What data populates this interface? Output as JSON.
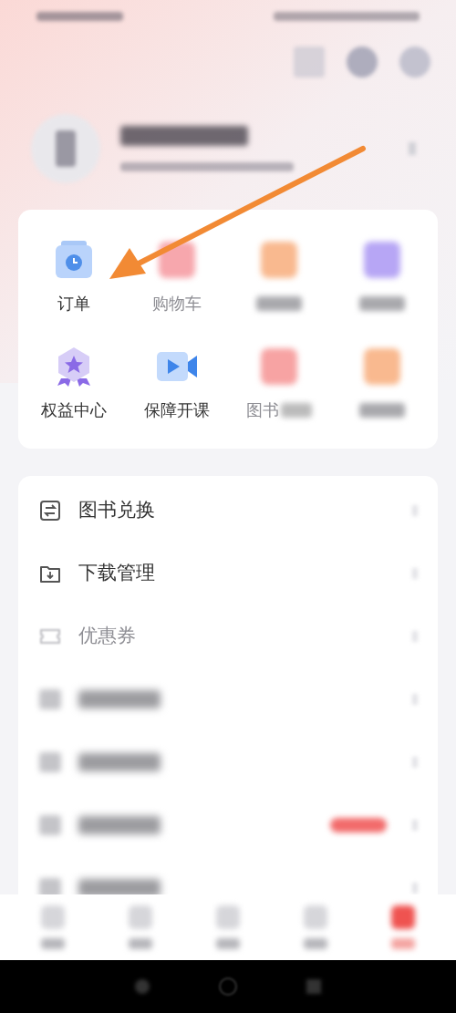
{
  "annotations": [
    {
      "kind": "arrow"
    }
  ],
  "shortcuts": [
    {
      "label": "订单",
      "kind": "sharp"
    },
    {
      "label": "购物车",
      "kind": "faded"
    },
    {
      "kind": "hidden"
    },
    {
      "kind": "hidden"
    },
    {
      "label": "权益中心",
      "kind": "sharp"
    },
    {
      "label": "保障开课",
      "kind": "sharp"
    },
    {
      "label": "图书",
      "kind": "faded"
    },
    {
      "kind": "hidden"
    }
  ],
  "menu": [
    {
      "label": "图书兑换",
      "kind": "sharp",
      "badge": false
    },
    {
      "label": "下载管理",
      "kind": "sharp",
      "badge": false
    },
    {
      "label": "优惠券",
      "kind": "faded",
      "badge": false
    },
    {
      "kind": "hidden",
      "badge": false
    },
    {
      "kind": "hidden",
      "badge": false
    },
    {
      "kind": "hidden",
      "badge": true
    },
    {
      "kind": "hidden",
      "badge": false
    }
  ]
}
